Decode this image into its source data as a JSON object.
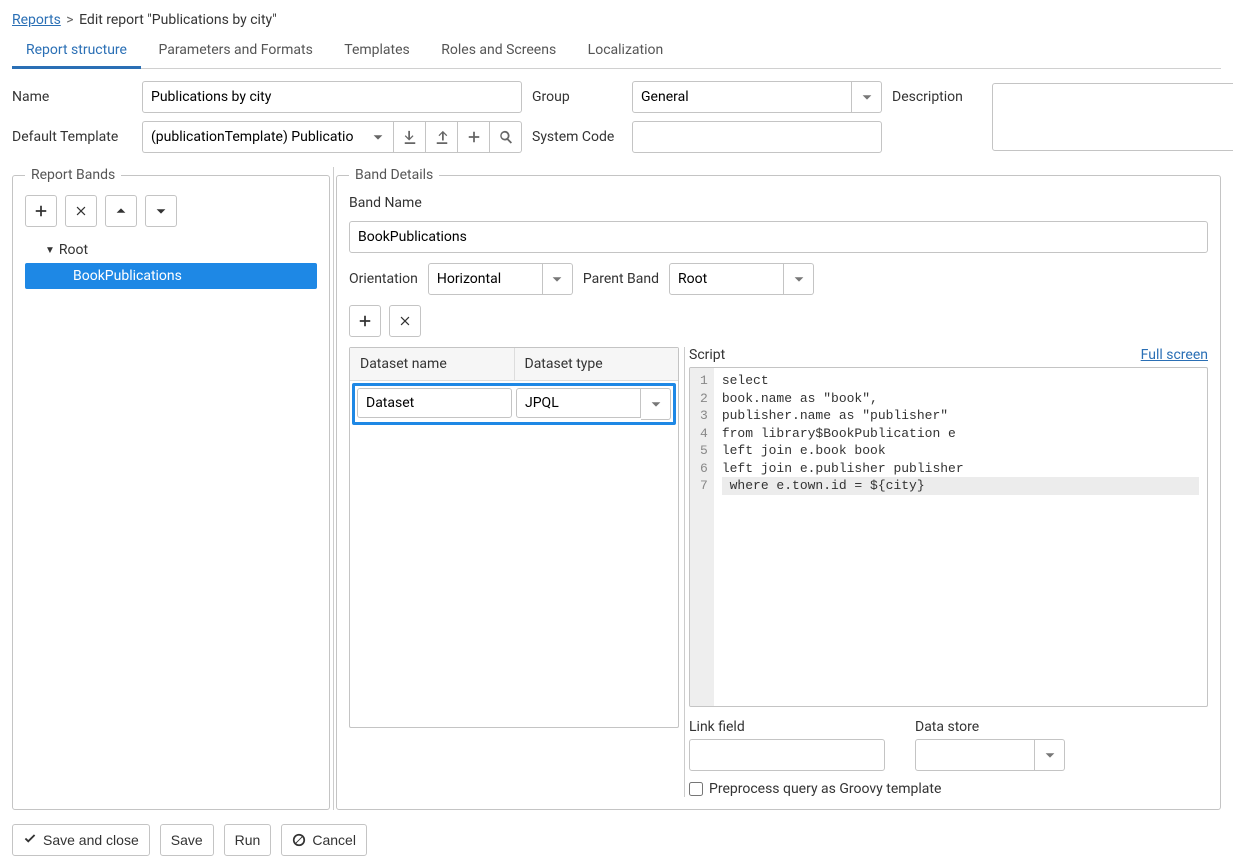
{
  "breadcrumb": {
    "root": "Reports",
    "separator": ">",
    "current": "Edit report \"Publications by city\""
  },
  "tabs": [
    "Report structure",
    "Parameters and Formats",
    "Templates",
    "Roles and Screens",
    "Localization"
  ],
  "active_tab": 0,
  "form": {
    "name_label": "Name",
    "name_value": "Publications by city",
    "group_label": "Group",
    "group_value": "General",
    "description_label": "Description",
    "description_value": "",
    "default_template_label": "Default Template",
    "default_template_value": "(publicationTemplate) Publications by city",
    "system_code_label": "System Code",
    "system_code_value": ""
  },
  "report_bands": {
    "legend": "Report Bands",
    "tree": [
      {
        "label": "Root",
        "level": 0,
        "expanded": true
      },
      {
        "label": "BookPublications",
        "level": 1,
        "selected": true
      }
    ]
  },
  "band_details": {
    "legend": "Band Details",
    "band_name_label": "Band Name",
    "band_name_value": "BookPublications",
    "orientation_label": "Orientation",
    "orientation_value": "Horizontal",
    "parent_label": "Parent Band",
    "parent_value": "Root",
    "dataset_table": {
      "headers": [
        "Dataset name",
        "Dataset type"
      ],
      "row": {
        "name": "Dataset",
        "type": "JPQL"
      }
    },
    "script_label": "Script",
    "full_screen": "Full screen",
    "script_lines": [
      "select",
      "book.name as \"book\",",
      "publisher.name as \"publisher\"",
      "from library$BookPublication e",
      "left join e.book book",
      "left join e.publisher publisher",
      " where e.town.id = ${city}"
    ],
    "active_line": 6,
    "link_field_label": "Link field",
    "link_field_value": "",
    "data_store_label": "Data store",
    "data_store_value": "",
    "preprocess_label": "Preprocess query as Groovy template"
  },
  "footer": {
    "save_close": "Save and close",
    "save": "Save",
    "run": "Run",
    "cancel": "Cancel"
  }
}
